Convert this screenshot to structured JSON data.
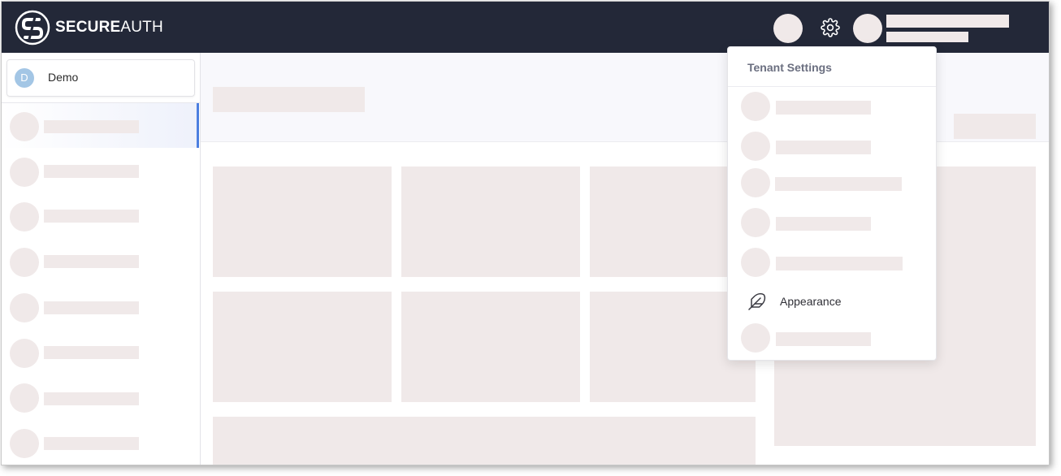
{
  "brand": {
    "name_bold": "SECURE",
    "name_light": "AUTH"
  },
  "sidebar": {
    "tenant": {
      "initial": "D",
      "name": "Demo"
    }
  },
  "dropdown": {
    "title": "Tenant Settings",
    "items": [
      {
        "label": ""
      },
      {
        "label": ""
      },
      {
        "label": ""
      },
      {
        "label": ""
      },
      {
        "label": ""
      },
      {
        "label": "Appearance",
        "icon": "feather-icon"
      },
      {
        "label": ""
      }
    ]
  },
  "colors": {
    "topbar": "#232838",
    "skeleton": "#f0e9e9",
    "active_accent": "#4c7fe0",
    "tenant_avatar": "#a3c6e5"
  }
}
